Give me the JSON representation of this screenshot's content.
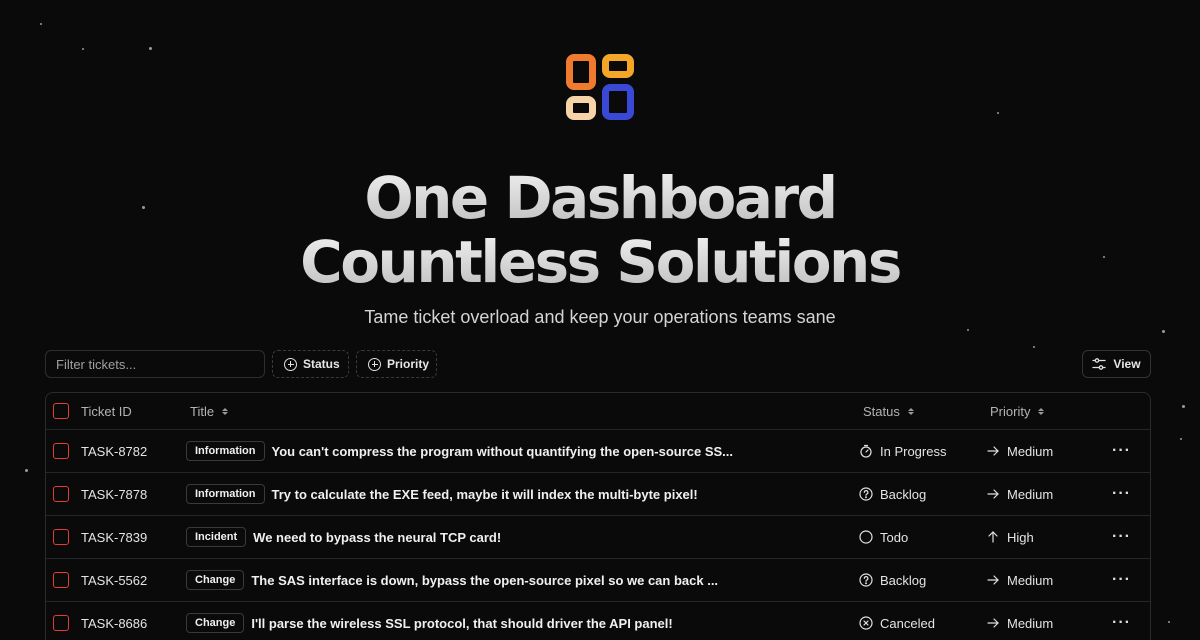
{
  "hero": {
    "title_line1": "One Dashboard",
    "title_line2": "Countless Solutions",
    "subtitle": "Tame ticket overload and keep your operations teams sane"
  },
  "toolbar": {
    "filter_placeholder": "Filter tickets...",
    "status_label": "Status",
    "priority_label": "Priority",
    "view_label": "View"
  },
  "table": {
    "headers": {
      "ticket_id": "Ticket ID",
      "title": "Title",
      "status": "Status",
      "priority": "Priority"
    },
    "rows": [
      {
        "id": "TASK-8782",
        "label": "Information",
        "title": "You can't compress the program without quantifying the open-source SS...",
        "status": "In Progress",
        "status_icon": "timer-icon",
        "priority": "Medium",
        "priority_icon": "arrow-right-icon"
      },
      {
        "id": "TASK-7878",
        "label": "Information",
        "title": "Try to calculate the EXE feed, maybe it will index the multi-byte pixel!",
        "status": "Backlog",
        "status_icon": "help-circle-icon",
        "priority": "Medium",
        "priority_icon": "arrow-right-icon"
      },
      {
        "id": "TASK-7839",
        "label": "Incident",
        "title": "We need to bypass the neural TCP card!",
        "status": "Todo",
        "status_icon": "circle-icon",
        "priority": "High",
        "priority_icon": "arrow-up-icon"
      },
      {
        "id": "TASK-5562",
        "label": "Change",
        "title": "The SAS interface is down, bypass the open-source pixel so we can back ...",
        "status": "Backlog",
        "status_icon": "help-circle-icon",
        "priority": "Medium",
        "priority_icon": "arrow-right-icon"
      },
      {
        "id": "TASK-8686",
        "label": "Change",
        "title": "I'll parse the wireless SSL protocol, that should driver the API panel!",
        "status": "Canceled",
        "status_icon": "x-circle-icon",
        "priority": "Medium",
        "priority_icon": "arrow-right-icon"
      }
    ]
  },
  "colors": {
    "background": "#0b0a0b",
    "checkbox_border": "#e23b3b",
    "logo_orange": "#f07a2e",
    "logo_amber": "#f3a628",
    "logo_cream": "#f6d4a8",
    "logo_blue": "#3a48d6"
  }
}
